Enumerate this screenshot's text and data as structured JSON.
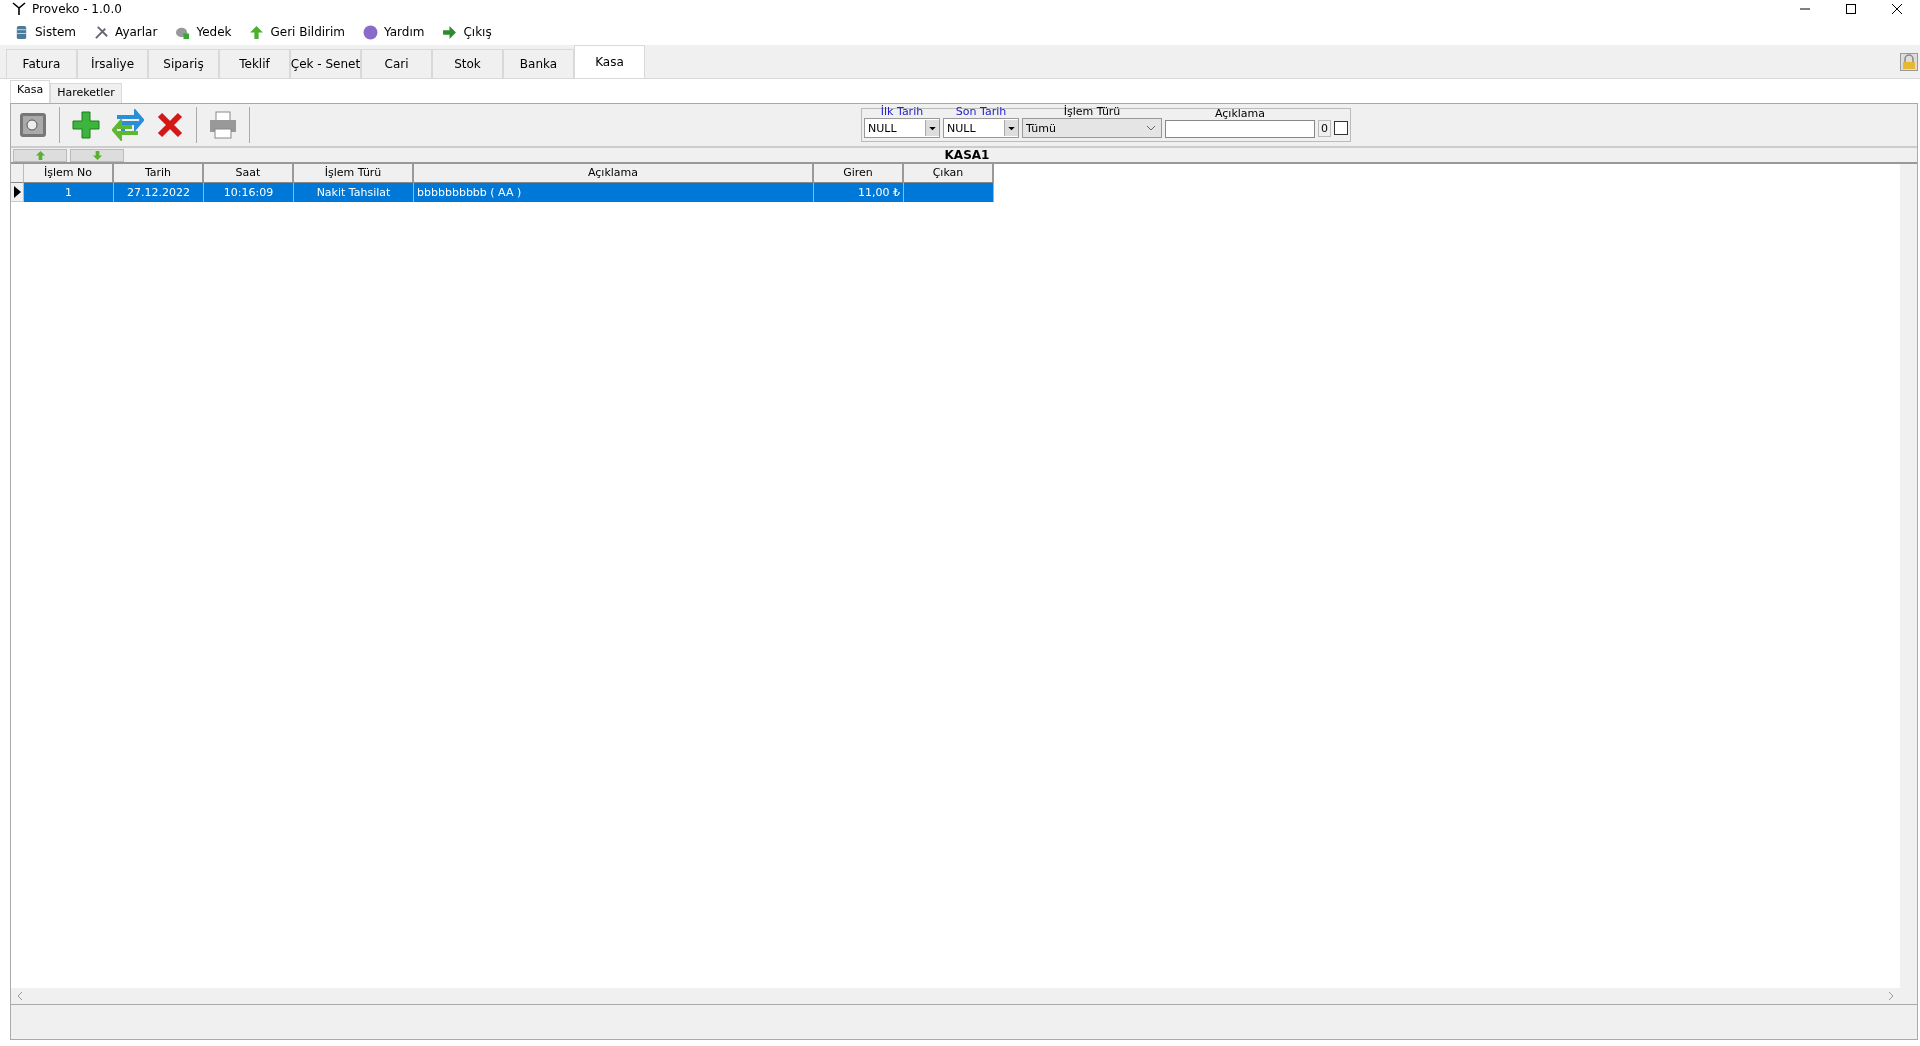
{
  "window": {
    "title": "Proveko - 1.0.0"
  },
  "menu": [
    {
      "label": "Sistem"
    },
    {
      "label": "Ayarlar"
    },
    {
      "label": "Yedek"
    },
    {
      "label": "Geri Bildirim"
    },
    {
      "label": "Yardım"
    },
    {
      "label": "Çıkış"
    }
  ],
  "tabs": [
    {
      "label": "Fatura",
      "selected": false
    },
    {
      "label": "İrsaliye",
      "selected": false
    },
    {
      "label": "Sipariş",
      "selected": false
    },
    {
      "label": "Teklif",
      "selected": false
    },
    {
      "label": "Çek - Senet",
      "selected": false
    },
    {
      "label": "Cari",
      "selected": false
    },
    {
      "label": "Stok",
      "selected": false
    },
    {
      "label": "Banka",
      "selected": false
    },
    {
      "label": "Kasa",
      "selected": true
    }
  ],
  "subtabs": [
    {
      "label": "Kasa",
      "selected": true
    },
    {
      "label": "Hareketler",
      "selected": false
    }
  ],
  "filters": {
    "first_date": {
      "label": "İlk Tarih",
      "value": "NULL"
    },
    "last_date": {
      "label": "Son Tarih",
      "value": "NULL"
    },
    "type": {
      "label": "İşlem Türü",
      "value": "Tümü"
    },
    "description": {
      "label": "Açıklama"
    },
    "count": "0",
    "checked": false
  },
  "grid": {
    "title": "KASA1",
    "columns": [
      "İşlem No",
      "Tarih",
      "Saat",
      "İşlem Türü",
      "Açıklama",
      "Giren",
      "Çıkan"
    ],
    "rows": [
      {
        "cells": [
          "1",
          "27.12.2022",
          "10:16:09",
          "Nakit Tahsilat",
          "bbbbbbbbbb ( AA )",
          "11,00 ₺",
          ""
        ],
        "selected": true
      }
    ]
  }
}
